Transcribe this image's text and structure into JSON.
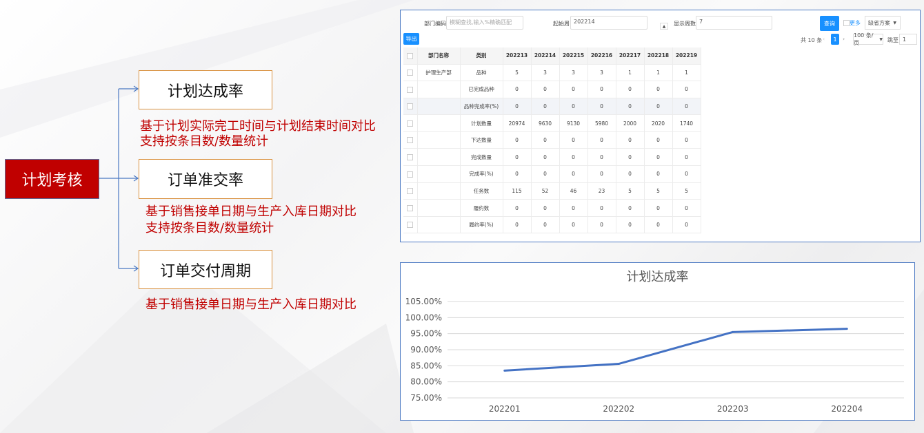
{
  "diagram": {
    "root": "计划考核",
    "items": [
      {
        "label": "计划达成率",
        "desc": [
          "基于计划实际完工时间与计划结束时间对比",
          "支持按条目数/数量统计"
        ]
      },
      {
        "label": "订单准交率",
        "desc": [
          "基于销售接单日期与生产入库日期对比",
          "支持按条目数/数量统计"
        ]
      },
      {
        "label": "订单交付周期",
        "desc": [
          "基于销售接单日期与生产入库日期对比"
        ]
      }
    ]
  },
  "filters": {
    "dept_code_label": "部门编码",
    "dept_code_placeholder": "模糊查找,输入%精确匹配",
    "start_period_label": "起始周",
    "start_period_value": "202214",
    "show_weeks_label": "显示周数",
    "show_weeks_value": "7",
    "query_button": "查询",
    "more_label": "更多",
    "scheme_label": "缺省方案",
    "export_button": "导出"
  },
  "pagination": {
    "total": "共 10 条",
    "current_page": "1",
    "page_size": "100 条/页",
    "goto_label": "跳至",
    "goto_value": "1"
  },
  "table": {
    "headers": [
      "部门名称",
      "类别",
      "202213",
      "202214",
      "202215",
      "202216",
      "202217",
      "202218",
      "202219"
    ],
    "rows": [
      [
        "护理生产部",
        "品种",
        "5",
        "3",
        "3",
        "3",
        "1",
        "1",
        "1"
      ],
      [
        "",
        "已完成品种",
        "0",
        "0",
        "0",
        "0",
        "0",
        "0",
        "0"
      ],
      [
        "",
        "品种完成率(%)",
        "0",
        "0",
        "0",
        "0",
        "0",
        "0",
        "0"
      ],
      [
        "",
        "计划数量",
        "20974",
        "9630",
        "9130",
        "5980",
        "2000",
        "2020",
        "1740"
      ],
      [
        "",
        "下达数量",
        "0",
        "0",
        "0",
        "0",
        "0",
        "0",
        "0"
      ],
      [
        "",
        "完成数量",
        "0",
        "0",
        "0",
        "0",
        "0",
        "0",
        "0"
      ],
      [
        "",
        "完成率(%)",
        "0",
        "0",
        "0",
        "0",
        "0",
        "0",
        "0"
      ],
      [
        "",
        "任务数",
        "115",
        "52",
        "46",
        "23",
        "5",
        "5",
        "5"
      ],
      [
        "",
        "履约数",
        "0",
        "0",
        "0",
        "0",
        "0",
        "0",
        "0"
      ],
      [
        "",
        "履约率(%)",
        "0",
        "0",
        "0",
        "0",
        "0",
        "0",
        "0"
      ]
    ]
  },
  "chart_data": {
    "type": "line",
    "title": "计划达成率",
    "categories": [
      "202201",
      "202202",
      "202203",
      "202204"
    ],
    "series": [
      {
        "values": [
          83.5,
          85.6,
          95.5,
          96.5
        ]
      }
    ],
    "ylim": [
      75,
      105
    ],
    "yticks": [
      "75.00%",
      "80.00%",
      "85.00%",
      "90.00%",
      "95.00%",
      "100.00%",
      "105.00%"
    ],
    "grid": true,
    "color": "#4472c4"
  }
}
